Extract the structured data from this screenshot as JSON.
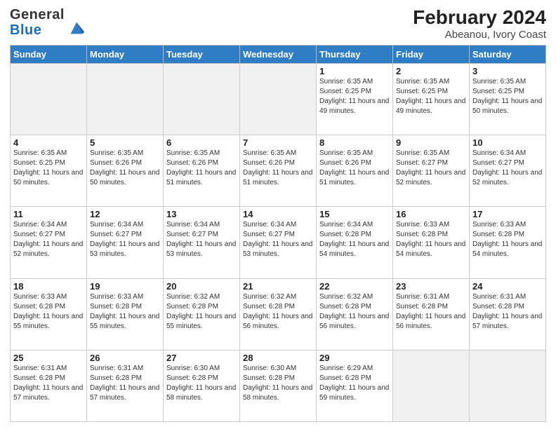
{
  "header": {
    "logo_general": "General",
    "logo_blue": "Blue",
    "title": "February 2024",
    "subtitle": "Abeanou, Ivory Coast"
  },
  "weekdays": [
    "Sunday",
    "Monday",
    "Tuesday",
    "Wednesday",
    "Thursday",
    "Friday",
    "Saturday"
  ],
  "weeks": [
    [
      {
        "day": "",
        "empty": true
      },
      {
        "day": "",
        "empty": true
      },
      {
        "day": "",
        "empty": true
      },
      {
        "day": "",
        "empty": true
      },
      {
        "day": "1",
        "sunrise": "6:35 AM",
        "sunset": "6:25 PM",
        "daylight": "11 hours and 49 minutes."
      },
      {
        "day": "2",
        "sunrise": "6:35 AM",
        "sunset": "6:25 PM",
        "daylight": "11 hours and 49 minutes."
      },
      {
        "day": "3",
        "sunrise": "6:35 AM",
        "sunset": "6:25 PM",
        "daylight": "11 hours and 50 minutes."
      }
    ],
    [
      {
        "day": "4",
        "sunrise": "6:35 AM",
        "sunset": "6:25 PM",
        "daylight": "11 hours and 50 minutes."
      },
      {
        "day": "5",
        "sunrise": "6:35 AM",
        "sunset": "6:26 PM",
        "daylight": "11 hours and 50 minutes."
      },
      {
        "day": "6",
        "sunrise": "6:35 AM",
        "sunset": "6:26 PM",
        "daylight": "11 hours and 51 minutes."
      },
      {
        "day": "7",
        "sunrise": "6:35 AM",
        "sunset": "6:26 PM",
        "daylight": "11 hours and 51 minutes."
      },
      {
        "day": "8",
        "sunrise": "6:35 AM",
        "sunset": "6:26 PM",
        "daylight": "11 hours and 51 minutes."
      },
      {
        "day": "9",
        "sunrise": "6:35 AM",
        "sunset": "6:27 PM",
        "daylight": "11 hours and 52 minutes."
      },
      {
        "day": "10",
        "sunrise": "6:34 AM",
        "sunset": "6:27 PM",
        "daylight": "11 hours and 52 minutes."
      }
    ],
    [
      {
        "day": "11",
        "sunrise": "6:34 AM",
        "sunset": "6:27 PM",
        "daylight": "11 hours and 52 minutes."
      },
      {
        "day": "12",
        "sunrise": "6:34 AM",
        "sunset": "6:27 PM",
        "daylight": "11 hours and 53 minutes."
      },
      {
        "day": "13",
        "sunrise": "6:34 AM",
        "sunset": "6:27 PM",
        "daylight": "11 hours and 53 minutes."
      },
      {
        "day": "14",
        "sunrise": "6:34 AM",
        "sunset": "6:27 PM",
        "daylight": "11 hours and 53 minutes."
      },
      {
        "day": "15",
        "sunrise": "6:34 AM",
        "sunset": "6:28 PM",
        "daylight": "11 hours and 54 minutes."
      },
      {
        "day": "16",
        "sunrise": "6:33 AM",
        "sunset": "6:28 PM",
        "daylight": "11 hours and 54 minutes."
      },
      {
        "day": "17",
        "sunrise": "6:33 AM",
        "sunset": "6:28 PM",
        "daylight": "11 hours and 54 minutes."
      }
    ],
    [
      {
        "day": "18",
        "sunrise": "6:33 AM",
        "sunset": "6:28 PM",
        "daylight": "11 hours and 55 minutes."
      },
      {
        "day": "19",
        "sunrise": "6:33 AM",
        "sunset": "6:28 PM",
        "daylight": "11 hours and 55 minutes."
      },
      {
        "day": "20",
        "sunrise": "6:32 AM",
        "sunset": "6:28 PM",
        "daylight": "11 hours and 55 minutes."
      },
      {
        "day": "21",
        "sunrise": "6:32 AM",
        "sunset": "6:28 PM",
        "daylight": "11 hours and 56 minutes."
      },
      {
        "day": "22",
        "sunrise": "6:32 AM",
        "sunset": "6:28 PM",
        "daylight": "11 hours and 56 minutes."
      },
      {
        "day": "23",
        "sunrise": "6:31 AM",
        "sunset": "6:28 PM",
        "daylight": "11 hours and 56 minutes."
      },
      {
        "day": "24",
        "sunrise": "6:31 AM",
        "sunset": "6:28 PM",
        "daylight": "11 hours and 57 minutes."
      }
    ],
    [
      {
        "day": "25",
        "sunrise": "6:31 AM",
        "sunset": "6:28 PM",
        "daylight": "11 hours and 57 minutes."
      },
      {
        "day": "26",
        "sunrise": "6:31 AM",
        "sunset": "6:28 PM",
        "daylight": "11 hours and 57 minutes."
      },
      {
        "day": "27",
        "sunrise": "6:30 AM",
        "sunset": "6:28 PM",
        "daylight": "11 hours and 58 minutes."
      },
      {
        "day": "28",
        "sunrise": "6:30 AM",
        "sunset": "6:28 PM",
        "daylight": "11 hours and 58 minutes."
      },
      {
        "day": "29",
        "sunrise": "6:29 AM",
        "sunset": "6:28 PM",
        "daylight": "11 hours and 59 minutes."
      },
      {
        "day": "",
        "empty": true
      },
      {
        "day": "",
        "empty": true
      }
    ]
  ]
}
